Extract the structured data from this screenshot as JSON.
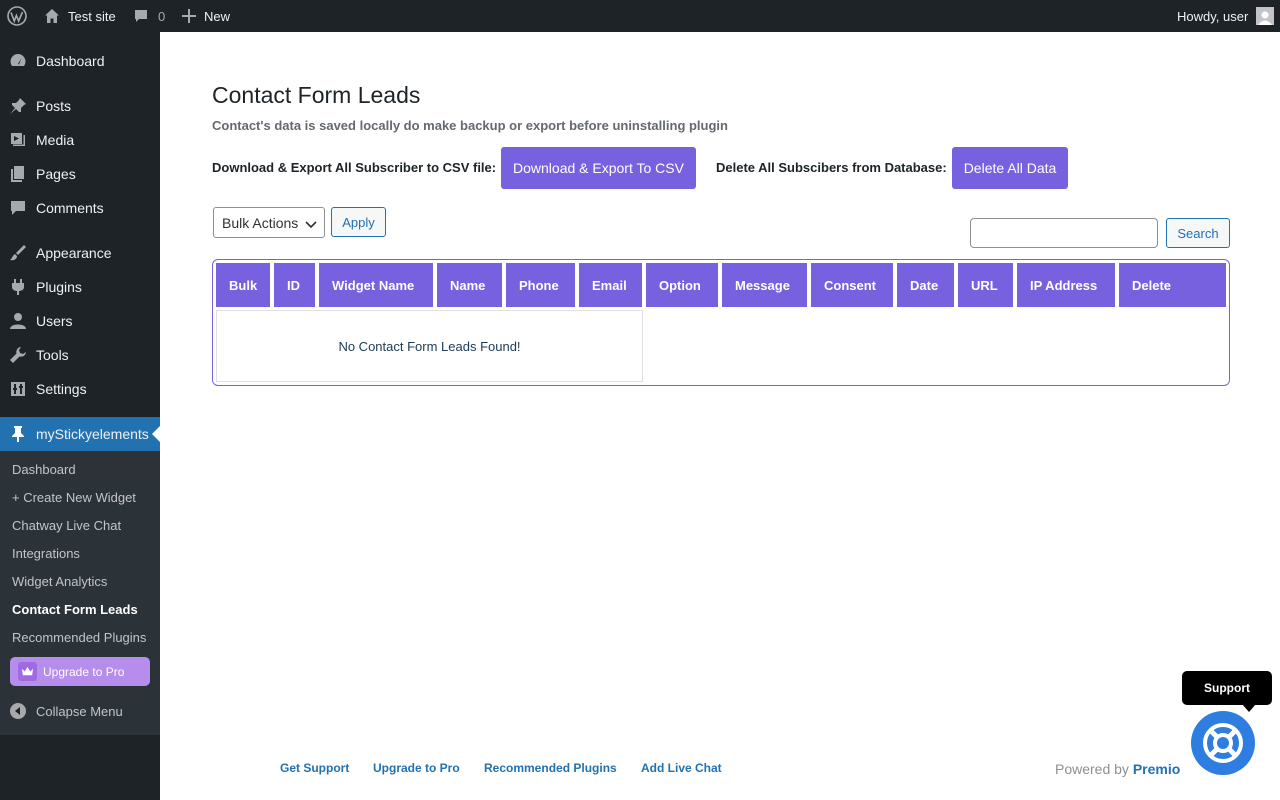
{
  "adminbar": {
    "site_name": "Test site",
    "comments_count": "0",
    "new_label": "New",
    "greeting": "Howdy, user"
  },
  "sidebar": {
    "items": [
      {
        "label": "Dashboard",
        "icon": "dashboard-icon"
      },
      {
        "label": "Posts",
        "icon": "pin-icon"
      },
      {
        "label": "Media",
        "icon": "media-icon"
      },
      {
        "label": "Pages",
        "icon": "pages-icon"
      },
      {
        "label": "Comments",
        "icon": "comment-icon"
      },
      {
        "label": "Appearance",
        "icon": "brush-icon"
      },
      {
        "label": "Plugins",
        "icon": "plug-icon"
      },
      {
        "label": "Users",
        "icon": "user-icon"
      },
      {
        "label": "Tools",
        "icon": "wrench-icon"
      },
      {
        "label": "Settings",
        "icon": "settings-icon"
      },
      {
        "label": "myStickyelements",
        "icon": "pin-icon"
      }
    ],
    "submenu": [
      "Dashboard",
      "+ Create New Widget",
      "Chatway Live Chat",
      "Integrations",
      "Widget Analytics",
      "Contact Form Leads",
      "Recommended Plugins"
    ],
    "upgrade_label": "Upgrade to Pro",
    "collapse_label": "Collapse Menu"
  },
  "main": {
    "title": "Contact Form Leads",
    "note": "Contact's data is saved locally do make backup or export before uninstalling plugin",
    "export_label": "Download & Export All Subscriber to CSV file:",
    "export_button": "Download & Export To CSV",
    "delete_label": "Delete All Subscibers from Database:",
    "delete_button": "Delete All Data",
    "bulk_select": "Bulk Actions",
    "apply_button": "Apply",
    "search_value": "",
    "search_button": "Search",
    "columns": [
      "Bulk",
      "ID",
      "Widget Name",
      "Name",
      "Phone",
      "Email",
      "Option",
      "Message",
      "Consent",
      "Date",
      "URL",
      "IP Address",
      "Delete"
    ],
    "empty_message": "No Contact Form Leads Found!"
  },
  "footer": {
    "links": [
      "Get Support",
      "Upgrade to Pro",
      "Recommended Plugins",
      "Add Live Chat"
    ],
    "powered_by": "Powered by",
    "brand": "Premio"
  },
  "support": {
    "tooltip": "Support"
  },
  "colors": {
    "accent_purple": "#7761df",
    "wp_blue": "#2271b1",
    "admin_dark": "#1d2327",
    "support_blue": "#2e7de0"
  }
}
